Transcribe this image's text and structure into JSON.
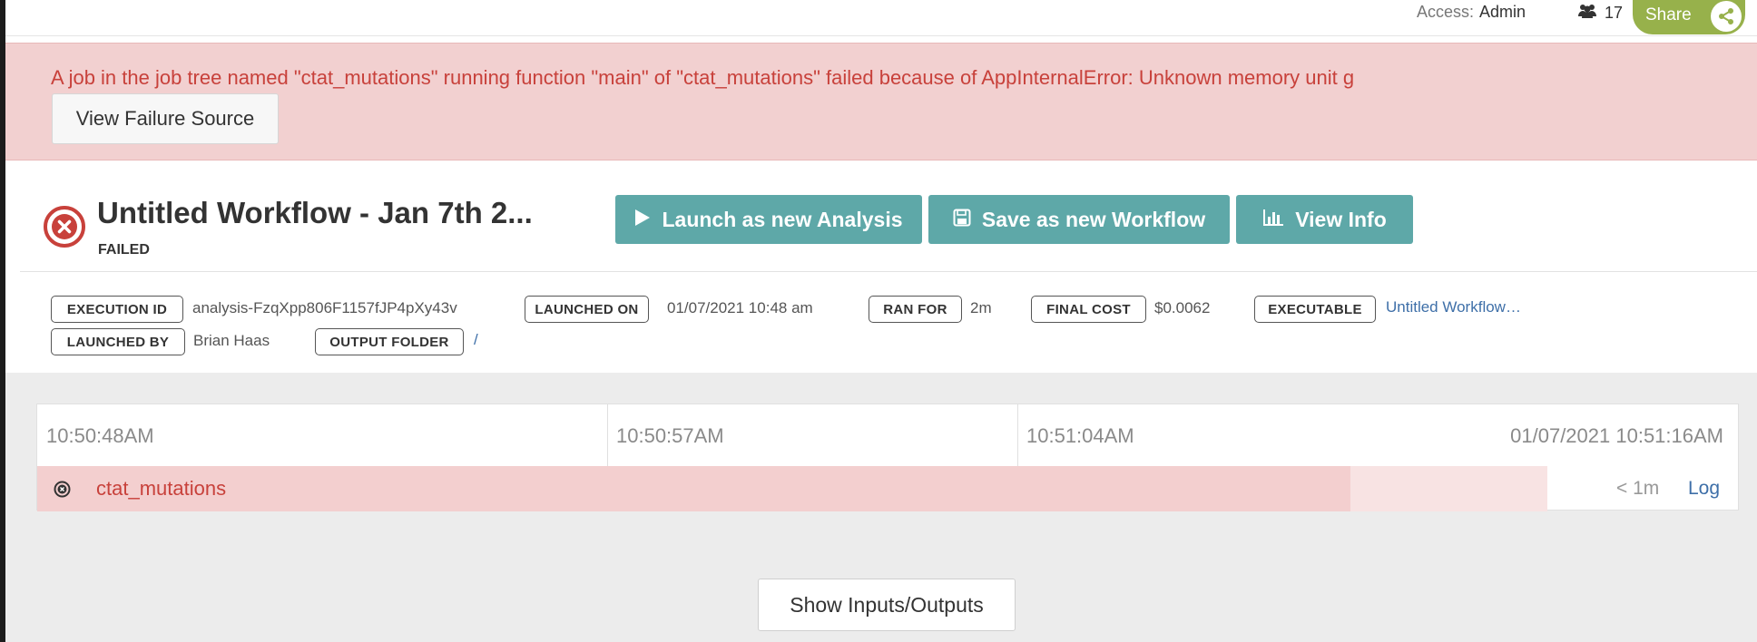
{
  "topbar": {
    "access_label": "Access:",
    "access_value": "Admin",
    "members_count": "17",
    "share_label": "Share"
  },
  "alert": {
    "message": "A job in the job tree named \"ctat_mutations\" running function \"main\" of \"ctat_mutations\" failed because of AppInternalError: Unknown memory unit g",
    "view_failure_label": "View Failure Source"
  },
  "header": {
    "title": "Untitled Workflow - Jan 7th 2...",
    "status": "FAILED",
    "launch_label": "Launch as new Analysis",
    "save_label": "Save as new Workflow",
    "info_label": "View Info"
  },
  "meta": {
    "execution_id_label": "EXECUTION ID",
    "execution_id": "analysis-FzqXpp806F1157fJP4pXy43v",
    "launched_on_label": "LAUNCHED ON",
    "launched_on": "01/07/2021 10:48 am",
    "ran_for_label": "RAN FOR",
    "ran_for": "2m",
    "final_cost_label": "FINAL COST",
    "final_cost": "$0.0062",
    "executable_label": "EXECUTABLE",
    "executable": "Untitled Workflow…",
    "launched_by_label": "LAUNCHED BY",
    "launched_by": "Brian Haas",
    "output_folder_label": "OUTPUT FOLDER",
    "output_folder": "/"
  },
  "timeline": {
    "ticks": [
      "10:50:48AM",
      "10:50:57AM",
      "10:51:04AM",
      "01/07/2021 10:51:16AM"
    ],
    "job_name": "ctat_mutations",
    "job_duration": "< 1m",
    "log_label": "Log"
  },
  "io_button_label": "Show Inputs/Outputs",
  "colors": {
    "accent": "#5ea8a8",
    "error": "#c8413b",
    "share": "#97b14b",
    "alert_bg": "#f2d0d0"
  }
}
